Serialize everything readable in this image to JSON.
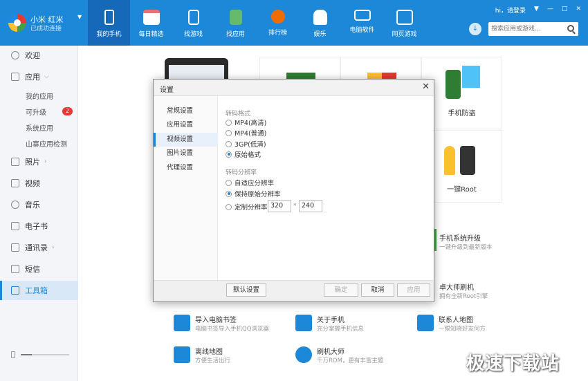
{
  "device": {
    "name": "小米 红米",
    "status": "已成功连接"
  },
  "nav": [
    {
      "label": "我的手机",
      "icon": "phone-icon",
      "color": "#ffffff"
    },
    {
      "label": "每日精选",
      "icon": "calendar-icon",
      "color": "#e57373"
    },
    {
      "label": "找游戏",
      "icon": "gamepad-icon",
      "color": "#ffffff"
    },
    {
      "label": "找应用",
      "icon": "app-bag-icon",
      "color": "#66bb6a"
    },
    {
      "label": "排行榜",
      "icon": "medal-icon",
      "color": "#ef6c00"
    },
    {
      "label": "娱乐",
      "icon": "bag-icon",
      "color": "#ffffff"
    },
    {
      "label": "电脑软件",
      "icon": "monitor-icon",
      "color": "#ffffff"
    },
    {
      "label": "网页游戏",
      "icon": "web-game-icon",
      "color": "#ffffff"
    }
  ],
  "topbar": {
    "greeting": "hi，请登录",
    "search_placeholder": "搜索应用或游戏..."
  },
  "sidebar": {
    "items": [
      {
        "label": "欢迎"
      },
      {
        "label": "应用"
      },
      {
        "label": "我的应用"
      },
      {
        "label": "可升级",
        "badge": "2"
      },
      {
        "label": "系统应用"
      },
      {
        "label": "山寨应用检测"
      },
      {
        "label": "照片"
      },
      {
        "label": "视频"
      },
      {
        "label": "音乐"
      },
      {
        "label": "电子书"
      },
      {
        "label": "通讯录"
      },
      {
        "label": "短信"
      },
      {
        "label": "工具箱"
      }
    ]
  },
  "tiles": [
    {
      "label": "手机防盗"
    },
    {
      "label": "一键Root"
    }
  ],
  "tools": [
    {
      "title": "手机系统升级",
      "desc": "一键升级到最新版本"
    },
    {
      "title": "卓大师刷机",
      "desc": "拥有全新Root引擎"
    },
    {
      "title": "导入电脑书签",
      "desc": "电脑书签导入手机QQ浏览器"
    },
    {
      "title": "关于手机",
      "desc": "充分掌握手机信息"
    },
    {
      "title": "联系人地图",
      "desc": "一眼知晓好友何方"
    },
    {
      "title": "离线地图",
      "desc": "方便生活出行"
    },
    {
      "title": "刷机大师",
      "desc": "千万ROM，更有丰富主题"
    }
  ],
  "dialog": {
    "title": "设置",
    "menu": [
      "常规设置",
      "应用设置",
      "视频设置",
      "图片设置",
      "代理设置"
    ],
    "format_title": "转码格式",
    "formats": [
      "MP4(高清)",
      "MP4(普通)",
      "3GP(低清)",
      "原始格式"
    ],
    "resolution_title": "转码分辨率",
    "resolutions": [
      "自适应分辨率",
      "保持原始分辨率",
      "定制分辨率"
    ],
    "custom_width": "320",
    "custom_height": "240",
    "times": "*",
    "buttons": {
      "default": "默认设置",
      "ok": "确定",
      "cancel": "取消",
      "apply": "应用"
    }
  },
  "watermark": "极速下载站"
}
